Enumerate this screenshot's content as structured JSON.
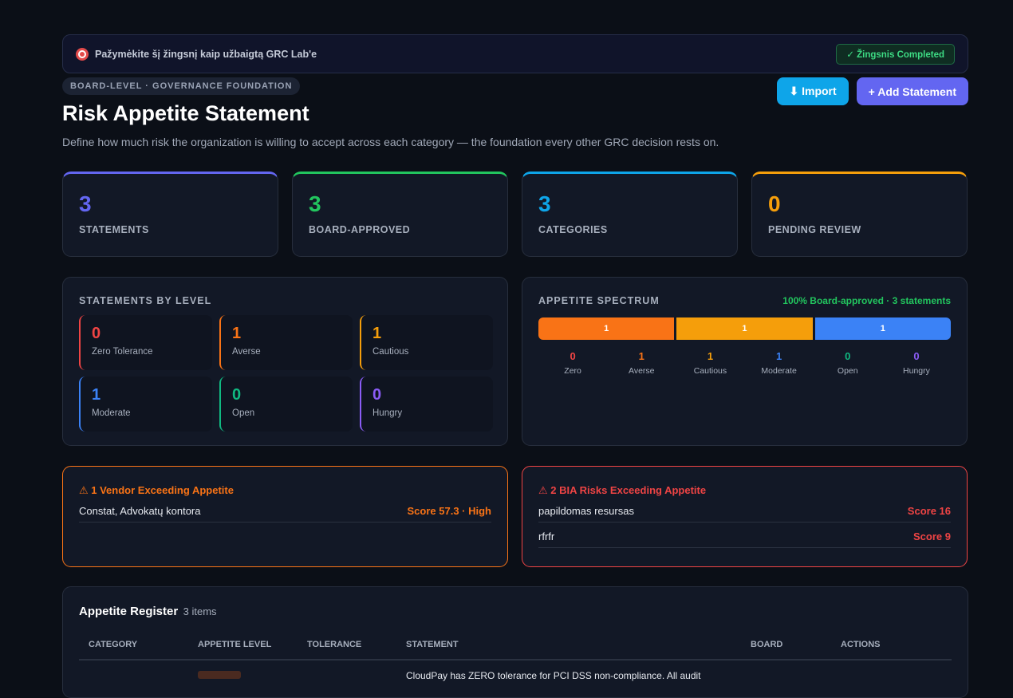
{
  "banner": {
    "text": "Pažymėkite šį žingsnį kaip užbaigtą GRC Lab'e",
    "badge": "✓ Žingsnis Completed"
  },
  "header": {
    "eyebrow": "BOARD-LEVEL · GOVERNANCE FOUNDATION",
    "title": "Risk Appetite Statement",
    "subtitle": "Define how much risk the organization is willing to accept across each category — the foundation every other GRC decision rests on.",
    "import_label": "⬇ Import",
    "add_label": "+ Add Statement"
  },
  "stats": [
    {
      "value": "3",
      "label": "STATEMENTS",
      "color": "#6366f1"
    },
    {
      "value": "3",
      "label": "BOARD-APPROVED",
      "color": "#22c55e"
    },
    {
      "value": "3",
      "label": "CATEGORIES",
      "color": "#0ea5e9"
    },
    {
      "value": "0",
      "label": "PENDING REVIEW",
      "color": "#f59e0b"
    }
  ],
  "levels_panel": {
    "title": "STATEMENTS BY LEVEL",
    "levels": [
      {
        "value": "0",
        "label": "Zero Tolerance",
        "color": "#ef4444"
      },
      {
        "value": "1",
        "label": "Averse",
        "color": "#f97316"
      },
      {
        "value": "1",
        "label": "Cautious",
        "color": "#f59e0b"
      },
      {
        "value": "1",
        "label": "Moderate",
        "color": "#3b82f6"
      },
      {
        "value": "0",
        "label": "Open",
        "color": "#10b981"
      },
      {
        "value": "0",
        "label": "Hungry",
        "color": "#8b5cf6"
      }
    ]
  },
  "spectrum": {
    "title": "APPETITE SPECTRUM",
    "note": "100% Board-approved · 3 statements",
    "segments": [
      {
        "value": "1",
        "color": "#f97316"
      },
      {
        "value": "1",
        "color": "#f59e0b"
      },
      {
        "value": "1",
        "color": "#3b82f6"
      }
    ],
    "legend": [
      {
        "value": "0",
        "label": "Zero",
        "color": "#ef4444"
      },
      {
        "value": "1",
        "label": "Averse",
        "color": "#f97316"
      },
      {
        "value": "1",
        "label": "Cautious",
        "color": "#f59e0b"
      },
      {
        "value": "1",
        "label": "Moderate",
        "color": "#3b82f6"
      },
      {
        "value": "0",
        "label": "Open",
        "color": "#10b981"
      },
      {
        "value": "0",
        "label": "Hungry",
        "color": "#8b5cf6"
      }
    ]
  },
  "vendor_alert": {
    "title": "⚠ 1 Vendor Exceeding Appetite",
    "color": "#f97316",
    "rows": [
      {
        "name": "Constat, Advokatų kontora",
        "score": "Score 57.3 · High"
      }
    ]
  },
  "bia_alert": {
    "title": "⚠ 2 BIA Risks Exceeding Appetite",
    "color": "#ef4444",
    "rows": [
      {
        "name": "papildomas resursas",
        "score": "Score 16"
      },
      {
        "name": "rfrfr",
        "score": "Score 9"
      }
    ]
  },
  "register": {
    "title": "Appetite Register",
    "count": "3 items",
    "columns": [
      "CATEGORY",
      "APPETITE LEVEL",
      "TOLERANCE",
      "STATEMENT",
      "BOARD",
      "ACTIONS"
    ],
    "first_row_statement": "CloudPay has ZERO tolerance for PCI DSS non-compliance. All audit"
  }
}
